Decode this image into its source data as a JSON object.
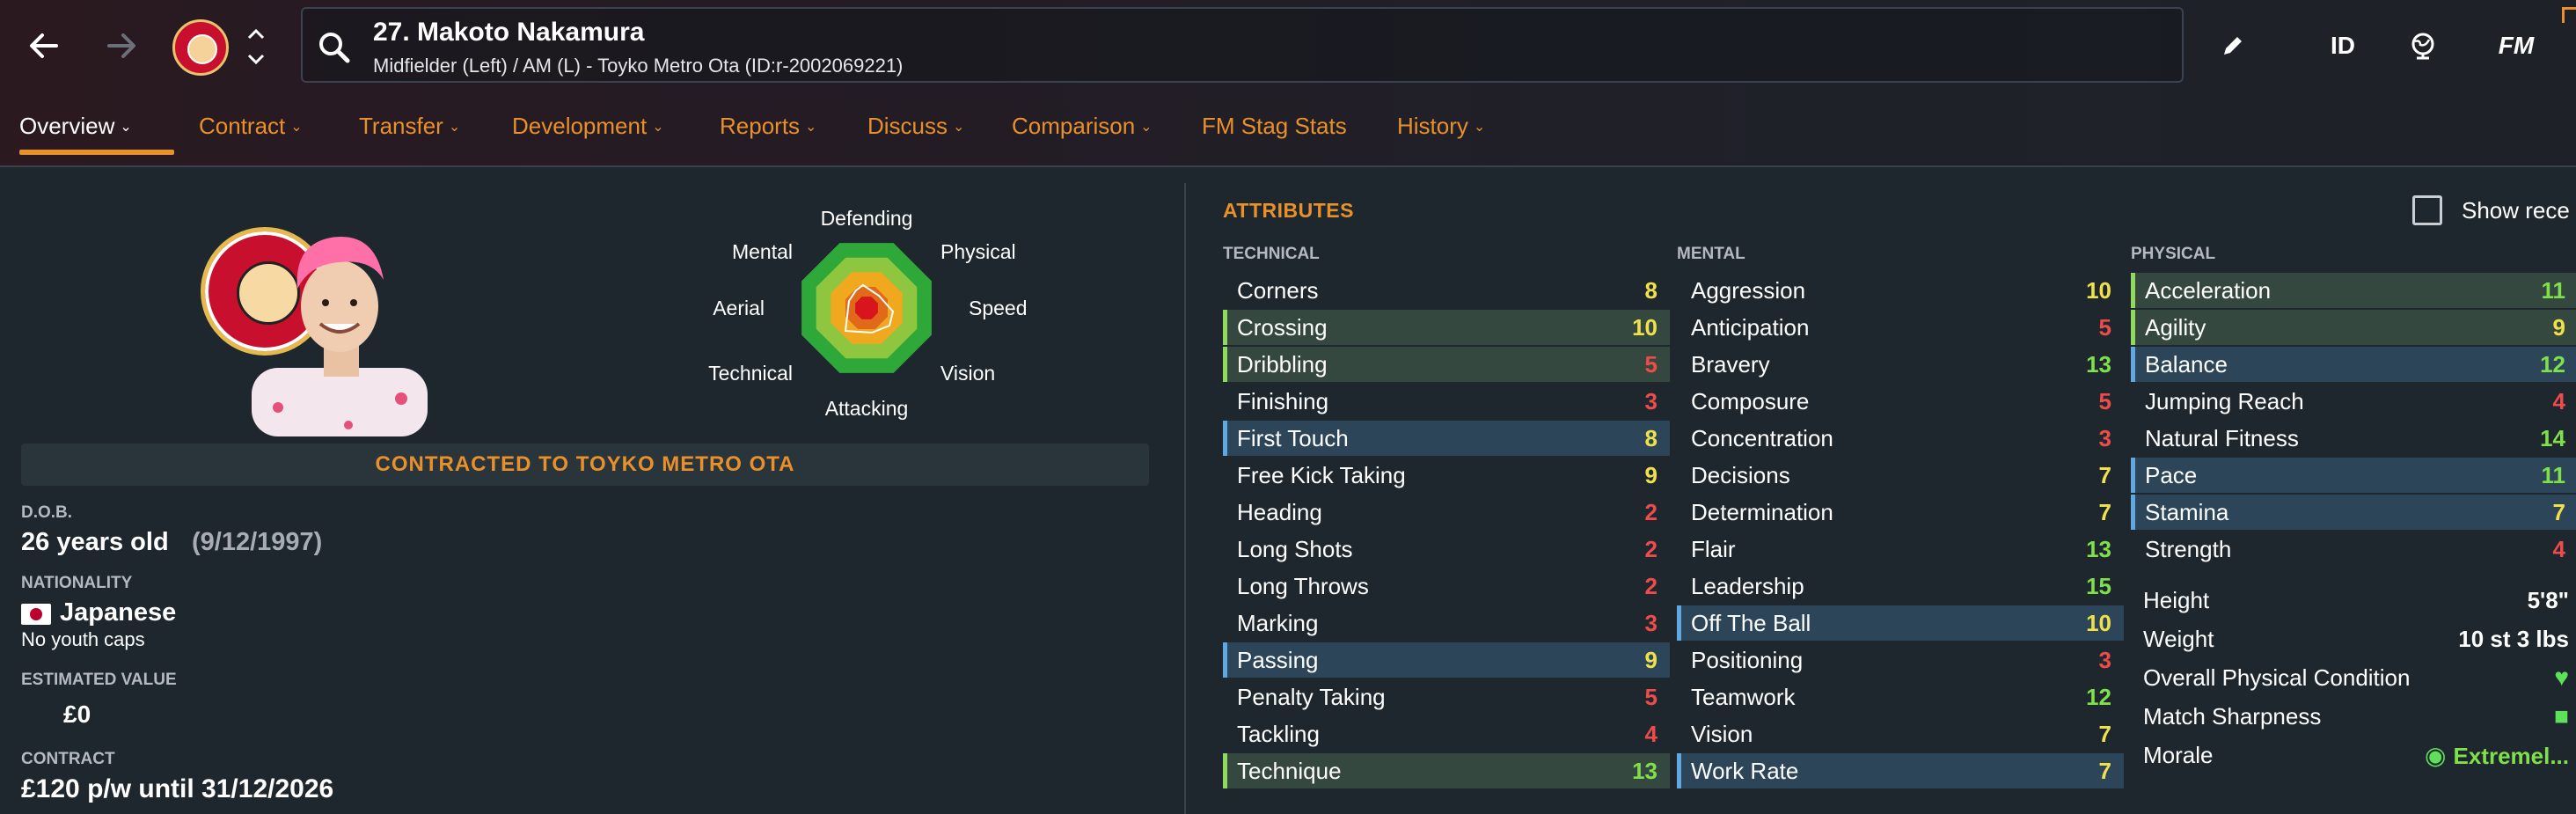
{
  "header": {
    "player_title": "27. Makoto Nakamura",
    "player_subtitle": "Midfielder (Left) / AM (L) - Toyko Metro Ota (ID:r-2002069221)",
    "id_label": "ID",
    "fm_label": "FM",
    "icons": [
      "back-arrow-icon",
      "forward-arrow-icon",
      "club-badge",
      "chevron-up-icon",
      "chevron-down-icon",
      "search-icon",
      "pencil-icon",
      "globe-icon"
    ]
  },
  "tabs": [
    {
      "label": "Overview",
      "has_menu": true,
      "active": true
    },
    {
      "label": "Contract",
      "has_menu": true
    },
    {
      "label": "Transfer",
      "has_menu": true
    },
    {
      "label": "Development",
      "has_menu": true
    },
    {
      "label": "Reports",
      "has_menu": true
    },
    {
      "label": "Discuss",
      "has_menu": true
    },
    {
      "label": "Comparison",
      "has_menu": true
    },
    {
      "label": "FM Stag Stats",
      "has_menu": false
    },
    {
      "label": "History",
      "has_menu": true
    }
  ],
  "profile": {
    "contract_banner": "CONTRACTED TO TOYKO METRO OTA",
    "dob_label": "D.O.B.",
    "age": "26 years old",
    "dob": "(9/12/1997)",
    "nationality_label": "NATIONALITY",
    "nationality": "Japanese",
    "youth_caps": "No youth caps",
    "value_label": "ESTIMATED VALUE",
    "value": "£0",
    "contract_label": "CONTRACT",
    "contract": "£120 p/w until 31/12/2026"
  },
  "radar": {
    "labels": [
      "Defending",
      "Physical",
      "Speed",
      "Vision",
      "Attacking",
      "Technical",
      "Aerial",
      "Mental"
    ],
    "colors": {
      "outer": "#2fa83a",
      "mid": "#8ec63f",
      "inner": "#f0a81e",
      "core": "#e06a1a",
      "player": "#d8141c"
    }
  },
  "attributes": {
    "title": "ATTRIBUTES",
    "show_recent_label": "Show rece",
    "technical": {
      "title": "TECHNICAL",
      "rows": [
        {
          "name": "Corners",
          "value": "8",
          "color": "yellow",
          "hl": ""
        },
        {
          "name": "Crossing",
          "value": "10",
          "color": "yellow",
          "hl": "green"
        },
        {
          "name": "Dribbling",
          "value": "5",
          "color": "red",
          "hl": "green"
        },
        {
          "name": "Finishing",
          "value": "3",
          "color": "red",
          "hl": ""
        },
        {
          "name": "First Touch",
          "value": "8",
          "color": "yellow",
          "hl": "blue"
        },
        {
          "name": "Free Kick Taking",
          "value": "9",
          "color": "yellow",
          "hl": ""
        },
        {
          "name": "Heading",
          "value": "2",
          "color": "red",
          "hl": ""
        },
        {
          "name": "Long Shots",
          "value": "2",
          "color": "red",
          "hl": ""
        },
        {
          "name": "Long Throws",
          "value": "2",
          "color": "red",
          "hl": ""
        },
        {
          "name": "Marking",
          "value": "3",
          "color": "red",
          "hl": ""
        },
        {
          "name": "Passing",
          "value": "9",
          "color": "yellow",
          "hl": "blue"
        },
        {
          "name": "Penalty Taking",
          "value": "5",
          "color": "red",
          "hl": ""
        },
        {
          "name": "Tackling",
          "value": "4",
          "color": "red",
          "hl": ""
        },
        {
          "name": "Technique",
          "value": "13",
          "color": "green",
          "hl": "green"
        }
      ]
    },
    "mental": {
      "title": "MENTAL",
      "rows": [
        {
          "name": "Aggression",
          "value": "10",
          "color": "yellow",
          "hl": ""
        },
        {
          "name": "Anticipation",
          "value": "5",
          "color": "red",
          "hl": ""
        },
        {
          "name": "Bravery",
          "value": "13",
          "color": "green",
          "hl": ""
        },
        {
          "name": "Composure",
          "value": "5",
          "color": "red",
          "hl": ""
        },
        {
          "name": "Concentration",
          "value": "3",
          "color": "red",
          "hl": ""
        },
        {
          "name": "Decisions",
          "value": "7",
          "color": "yellow",
          "hl": ""
        },
        {
          "name": "Determination",
          "value": "7",
          "color": "yellow",
          "hl": ""
        },
        {
          "name": "Flair",
          "value": "13",
          "color": "green",
          "hl": ""
        },
        {
          "name": "Leadership",
          "value": "15",
          "color": "green",
          "hl": ""
        },
        {
          "name": "Off The Ball",
          "value": "10",
          "color": "yellow",
          "hl": "blue"
        },
        {
          "name": "Positioning",
          "value": "3",
          "color": "red",
          "hl": ""
        },
        {
          "name": "Teamwork",
          "value": "12",
          "color": "green",
          "hl": ""
        },
        {
          "name": "Vision",
          "value": "7",
          "color": "yellow",
          "hl": ""
        },
        {
          "name": "Work Rate",
          "value": "7",
          "color": "yellow",
          "hl": "blue"
        }
      ]
    },
    "physical": {
      "title": "PHYSICAL",
      "rows": [
        {
          "name": "Acceleration",
          "value": "11",
          "color": "green",
          "hl": "green"
        },
        {
          "name": "Agility",
          "value": "9",
          "color": "yellow",
          "hl": "green"
        },
        {
          "name": "Balance",
          "value": "12",
          "color": "green",
          "hl": "blue"
        },
        {
          "name": "Jumping Reach",
          "value": "4",
          "color": "red",
          "hl": ""
        },
        {
          "name": "Natural Fitness",
          "value": "14",
          "color": "green",
          "hl": ""
        },
        {
          "name": "Pace",
          "value": "11",
          "color": "green",
          "hl": "blue"
        },
        {
          "name": "Stamina",
          "value": "7",
          "color": "yellow",
          "hl": "blue"
        },
        {
          "name": "Strength",
          "value": "4",
          "color": "red",
          "hl": ""
        }
      ],
      "extra": [
        {
          "name": "Height",
          "value": "5'8\""
        },
        {
          "name": "Weight",
          "value": "10 st 3 lbs"
        },
        {
          "name": "Overall Physical Condition",
          "icon": "heart-icon"
        },
        {
          "name": "Match Sharpness",
          "icon": "thumbs-up-icon"
        },
        {
          "name": "Morale",
          "value": "Extremel...",
          "icon": "morale-icon"
        }
      ]
    }
  }
}
